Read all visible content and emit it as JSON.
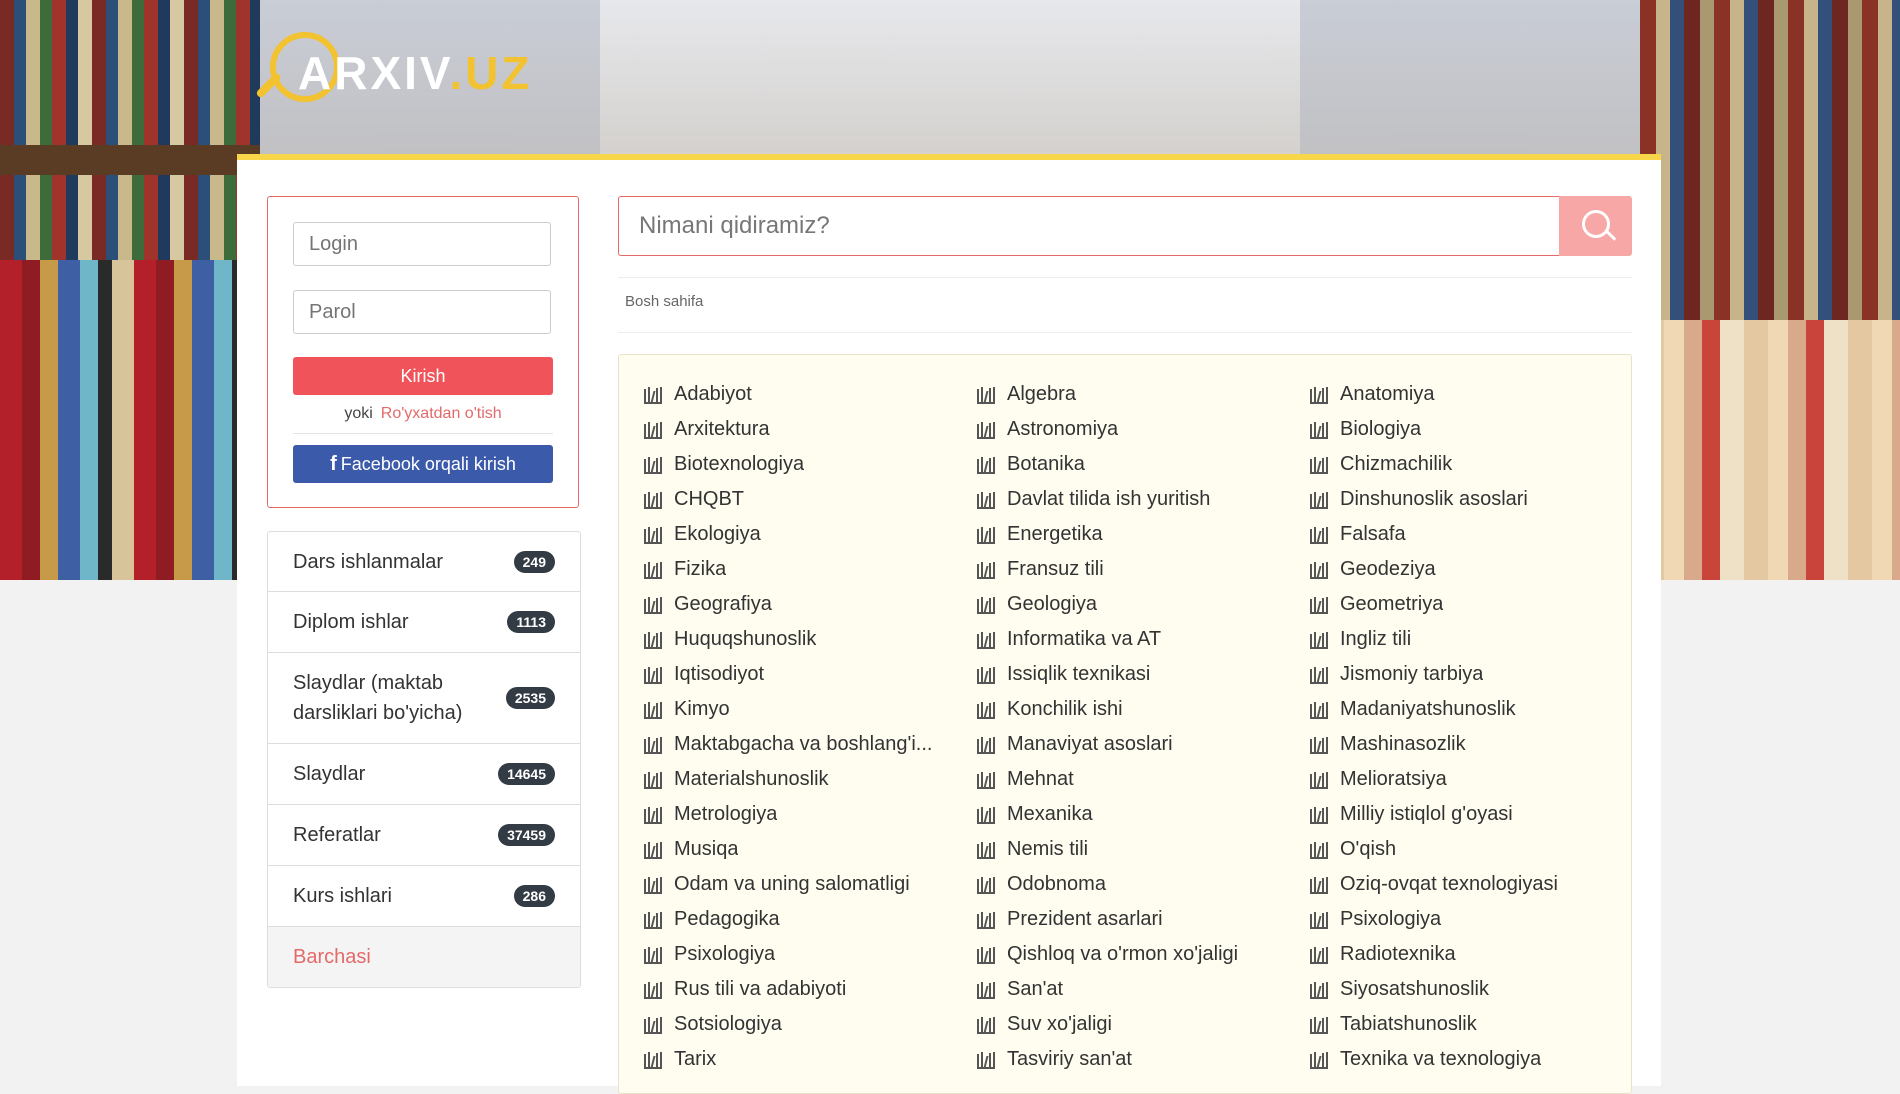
{
  "logo": {
    "text_main": "ARXIV",
    "text_dot": ".UZ"
  },
  "login": {
    "login_placeholder": "Login",
    "password_placeholder": "Parol",
    "submit_label": "Kirish",
    "or_text": "yoki",
    "register_link": "Ro'yxatdan o'tish",
    "facebook_label": "Facebook orqali kirish"
  },
  "categories": [
    {
      "label": "Dars ishlanmalar",
      "count": "249"
    },
    {
      "label": "Diplom ishlar",
      "count": "1113"
    },
    {
      "label": "Slaydlar (maktab darsliklari bo'yicha)",
      "count": "2535"
    },
    {
      "label": "Slaydlar",
      "count": "14645"
    },
    {
      "label": "Referatlar",
      "count": "37459"
    },
    {
      "label": "Kurs ishlari",
      "count": "286"
    }
  ],
  "all_label": "Barchasi",
  "search": {
    "placeholder": "Nimani qidiramiz?"
  },
  "breadcrumb": "Bosh sahifa",
  "subjects": [
    "Adabiyot",
    "Algebra",
    "Anatomiya",
    "Arxitektura",
    "Astronomiya",
    "Biologiya",
    "Biotexnologiya",
    "Botanika",
    "Chizmachilik",
    "CHQBT",
    "Davlat tilida ish yuritish",
    "Dinshunoslik asoslari",
    "Ekologiya",
    "Energetika",
    "Falsafa",
    "Fizika",
    "Fransuz tili",
    "Geodeziya",
    "Geografiya",
    "Geologiya",
    "Geometriya",
    "Huquqshunoslik",
    "Informatika va AT",
    "Ingliz tili",
    "Iqtisodiyot",
    "Issiqlik texnikasi",
    "Jismoniy tarbiya",
    "Kimyo",
    "Konchilik ishi",
    "Madaniyatshunoslik",
    "Maktabgacha va boshlang'i...",
    "Manaviyat asoslari",
    "Mashinasozlik",
    "Materialshunoslik",
    "Mehnat",
    "Melioratsiya",
    "Metrologiya",
    "Mexanika",
    "Milliy istiqlol g'oyasi",
    "Musiqa",
    "Nemis tili",
    "O'qish",
    "Odam va uning salomatligi",
    "Odobnoma",
    "Oziq-ovqat texnologiyasi",
    "Pedagogika",
    "Prezident asarlari",
    "Psixologiya",
    "Psixologiya",
    "Qishloq va o'rmon xo'jaligi",
    "Radiotexnika",
    "Rus tili va adabiyoti",
    "San'at",
    "Siyosatshunoslik",
    "Sotsiologiya",
    "Suv xo'jaligi",
    "Tabiatshunoslik",
    "Tarix",
    "Tasviriy san'at",
    "Texnika va texnologiya"
  ],
  "colors": {
    "accent_red": "#e46a6a",
    "button_red": "#f0535a",
    "facebook_blue": "#3b5aa9",
    "logo_yellow": "#f2c230",
    "badge_dark": "#333b44"
  },
  "icons": {
    "subject_icon": "library-books-icon",
    "search_icon": "search-icon"
  }
}
